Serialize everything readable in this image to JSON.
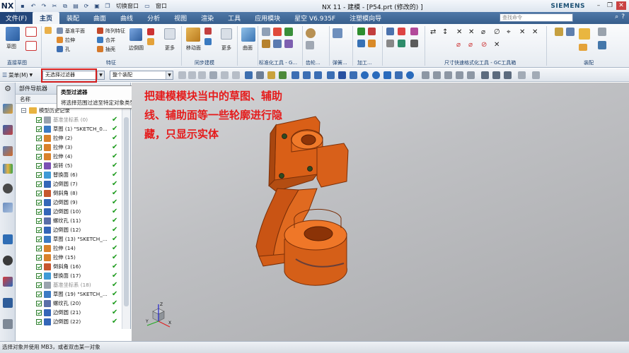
{
  "app": {
    "logo": "NX",
    "title": "NX 11 - 建模 - [P54.prt  (修改的) ]",
    "brand": "SIEMENS",
    "qat_window_switch": "切换窗口",
    "qat_window": "窗口"
  },
  "menu": {
    "file": "文件(F)",
    "tabs": [
      "主页",
      "装配",
      "曲面",
      "曲线",
      "分析",
      "视图",
      "渲染",
      "工具",
      "应用模块",
      "星空 V6.935F",
      "注塑模向导"
    ],
    "search_placeholder": "查找命令"
  },
  "ribbon": {
    "sketch": "草图",
    "datum_plane": "基准平面",
    "extrude": "拉伸",
    "hole": "孔",
    "array_feature": "阵列特征",
    "unite": "合并",
    "shell": "抽壳",
    "edge_blend": "边倒圆",
    "more": "更多",
    "move_face": "移动面",
    "surface": "曲面",
    "group_labels": {
      "direct_sketch": "直接草图",
      "feature": "特征",
      "sync_modeling": "同步建模",
      "standardize": "标准化工具 - G...",
      "gear": "齿轮...",
      "spring": "弹簧...",
      "machining": "加工...",
      "dimension_quick": "尺寸快速格式化工具 - GC工具箱",
      "assembly": "装配"
    }
  },
  "toolbar2": {
    "menu_label": "菜单(M)",
    "filter_value": "无选择过滤器",
    "assembly_value": "整个装配"
  },
  "tooltip": {
    "title": "类型过滤器",
    "body": "将选择范围过滤至特定对象类型。"
  },
  "navigator": {
    "title": "部件导航器",
    "column_name": "名称",
    "root": "模型历史记录",
    "items": [
      {
        "label": "基准坐标系 (0)",
        "gray": true,
        "icon": "datum-csys",
        "color": "#9aa3ad"
      },
      {
        "label": "草图 (1) \"SKETCH_0...",
        "gray": false,
        "icon": "sketch",
        "color": "#3c7bc4"
      },
      {
        "label": "拉伸 (2)",
        "gray": false,
        "icon": "extrude",
        "color": "#d9822b"
      },
      {
        "label": "拉伸 (3)",
        "gray": false,
        "icon": "extrude",
        "color": "#d9822b"
      },
      {
        "label": "拉伸 (4)",
        "gray": false,
        "icon": "extrude",
        "color": "#d9822b"
      },
      {
        "label": "旋转 (5)",
        "gray": false,
        "icon": "revolve",
        "color": "#7b4fb3"
      },
      {
        "label": "替换面 (6)",
        "gray": false,
        "icon": "replace-face",
        "color": "#3f9ad6"
      },
      {
        "label": "边倒圆 (7)",
        "gray": false,
        "icon": "edge-blend",
        "color": "#3466b8"
      },
      {
        "label": "倒斜角 (8)",
        "gray": false,
        "icon": "chamfer",
        "color": "#c6562e"
      },
      {
        "label": "边倒圆 (9)",
        "gray": false,
        "icon": "edge-blend",
        "color": "#3466b8"
      },
      {
        "label": "边倒圆 (10)",
        "gray": false,
        "icon": "edge-blend",
        "color": "#3466b8"
      },
      {
        "label": "螺纹孔 (11)",
        "gray": false,
        "icon": "threaded-hole",
        "color": "#5a6fa8"
      },
      {
        "label": "边倒圆 (12)",
        "gray": false,
        "icon": "edge-blend",
        "color": "#3466b8"
      },
      {
        "label": "草图 (13) \"SKETCH_...",
        "gray": false,
        "icon": "sketch",
        "color": "#3c7bc4"
      },
      {
        "label": "拉伸 (14)",
        "gray": false,
        "icon": "extrude",
        "color": "#d9822b"
      },
      {
        "label": "拉伸 (15)",
        "gray": false,
        "icon": "extrude",
        "color": "#d9822b"
      },
      {
        "label": "倒斜角 (16)",
        "gray": false,
        "icon": "chamfer",
        "color": "#c6562e"
      },
      {
        "label": "替换面 (17)",
        "gray": false,
        "icon": "replace-face",
        "color": "#3f9ad6"
      },
      {
        "label": "基准坐标系 (18)",
        "gray": true,
        "icon": "datum-csys",
        "color": "#9aa3ad"
      },
      {
        "label": "草图 (19) \"SKETCH_...",
        "gray": false,
        "icon": "sketch",
        "color": "#3c7bc4"
      },
      {
        "label": "螺纹孔 (20)",
        "gray": false,
        "icon": "threaded-hole",
        "color": "#5a6fa8"
      },
      {
        "label": "边倒圆 (21)",
        "gray": false,
        "icon": "edge-blend",
        "color": "#3466b8"
      },
      {
        "label": "边倒圆 (22)",
        "gray": false,
        "icon": "edge-blend",
        "color": "#3466b8"
      }
    ]
  },
  "viewport": {
    "annotation": "把建模模块当中的草图、辅助线、辅助面等一些轮廓进行隐藏，只显示实体",
    "axis_labels": [
      "X",
      "Y",
      "Z"
    ]
  },
  "status": {
    "message": "选择对象并使用 MB3，或者双击某一对象"
  },
  "colors": {
    "part": "#e0661b",
    "part_dark": "#8f3a0b",
    "menu_bar": "#3f6898",
    "annotation": "#e51b1b",
    "highlight_box": "#d41c1c"
  }
}
